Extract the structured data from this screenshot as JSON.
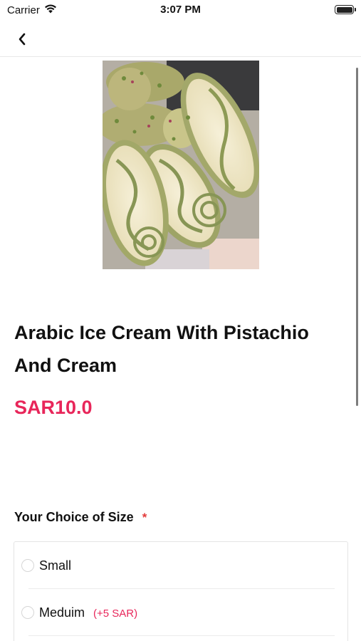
{
  "status_bar": {
    "carrier": "Carrier",
    "time": "3:07 PM"
  },
  "nav": {
    "back_icon": "chevron-left-icon"
  },
  "product": {
    "image_alt": "pistachio ice cream rolls",
    "title": "Arabic Ice Cream With Pistachio And Cream",
    "price": "SAR10.0"
  },
  "size_section": {
    "title": "Your Choice of Size",
    "required_mark": "*",
    "options": [
      {
        "label": "Small",
        "extra": ""
      },
      {
        "label": "Meduim",
        "extra": "(+5 SAR)"
      }
    ]
  },
  "colors": {
    "accent": "#e8265a",
    "required": "#e33b3b"
  }
}
